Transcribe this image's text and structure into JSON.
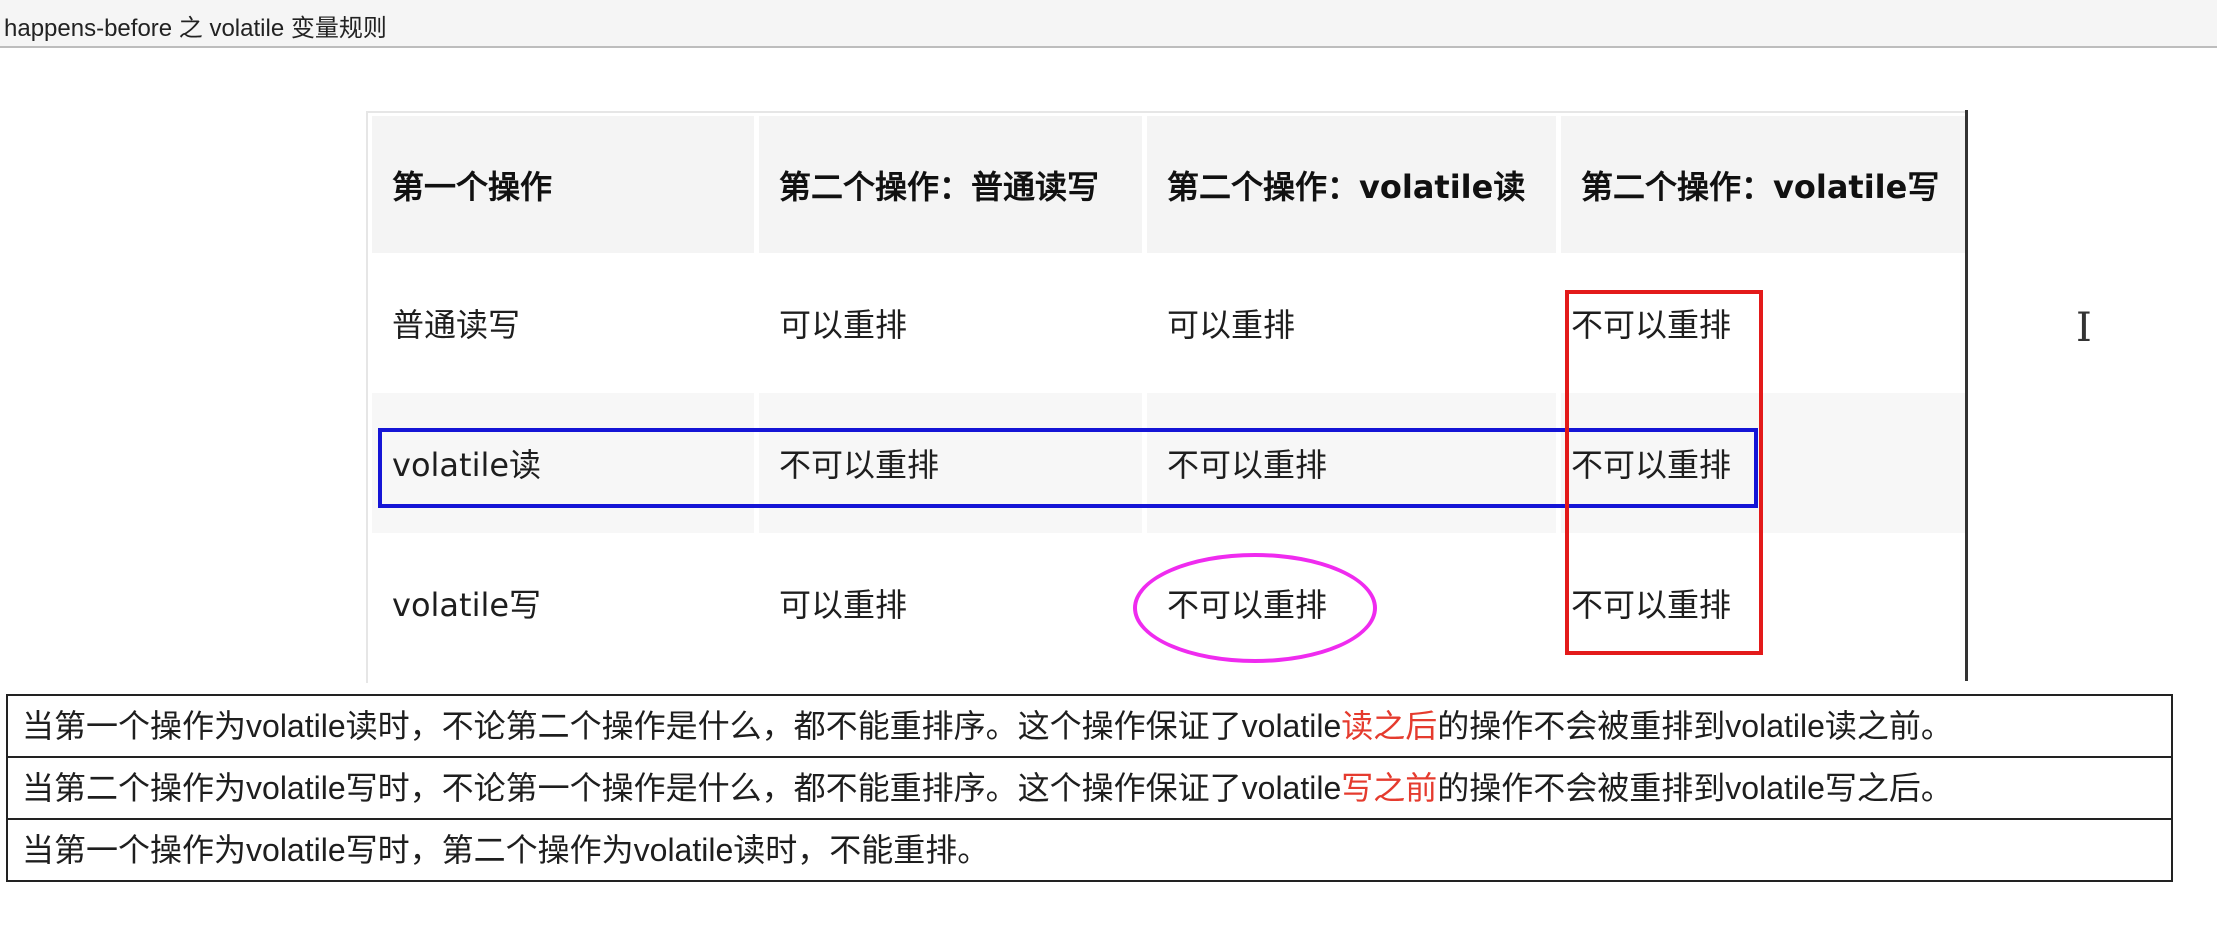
{
  "page": {
    "title": "happens-before 之 volatile 变量规则"
  },
  "rules_table": {
    "headers": [
      "第一个操作",
      "第二个操作：普通读写",
      "第二个操作：volatile读",
      "第二个操作：volatile写"
    ],
    "rows": [
      [
        "普通读写",
        "可以重排",
        "可以重排",
        "不可以重排"
      ],
      [
        "volatile读",
        "不可以重排",
        "不可以重排",
        "不可以重排"
      ],
      [
        "volatile写",
        "可以重排",
        "不可以重排",
        "不可以重排"
      ]
    ]
  },
  "annotations": {
    "blue_box": "volatile读 row",
    "red_box": "volatile写 column",
    "magenta_ellipse": "volatile写 / volatile读 cell"
  },
  "notes": [
    {
      "p1": "当第一个操作为",
      "k1": "volatile",
      "p2": "读时，不论第二个操作是什么，都不能重排序。这个操作保证了",
      "k2": "volatile",
      "hl": "读之后",
      "p3": "的操作不会被重排到",
      "k3": "volatile",
      "p4": "读之前。"
    },
    {
      "p1": "当第二个操作为",
      "k1": "volatile",
      "p2": "写时，不论第一个操作是什么，都不能重排序。这个操作保证了",
      "k2": "volatile",
      "hl": "写之前",
      "p3": "的操作不会被重排到",
      "k3": "volatile",
      "p4": "写之后。"
    },
    {
      "p1": "当第一个操作为",
      "k1": "volatile",
      "p2": "写时，第二个操作为",
      "k2": "volatile",
      "p3": "读时，不能重排。"
    }
  ],
  "colors": {
    "blue_box": "#1515d6",
    "red_box": "#e31a1a",
    "magenta_ellipse": "#ef2bef",
    "highlight_text": "#e53b2e"
  }
}
